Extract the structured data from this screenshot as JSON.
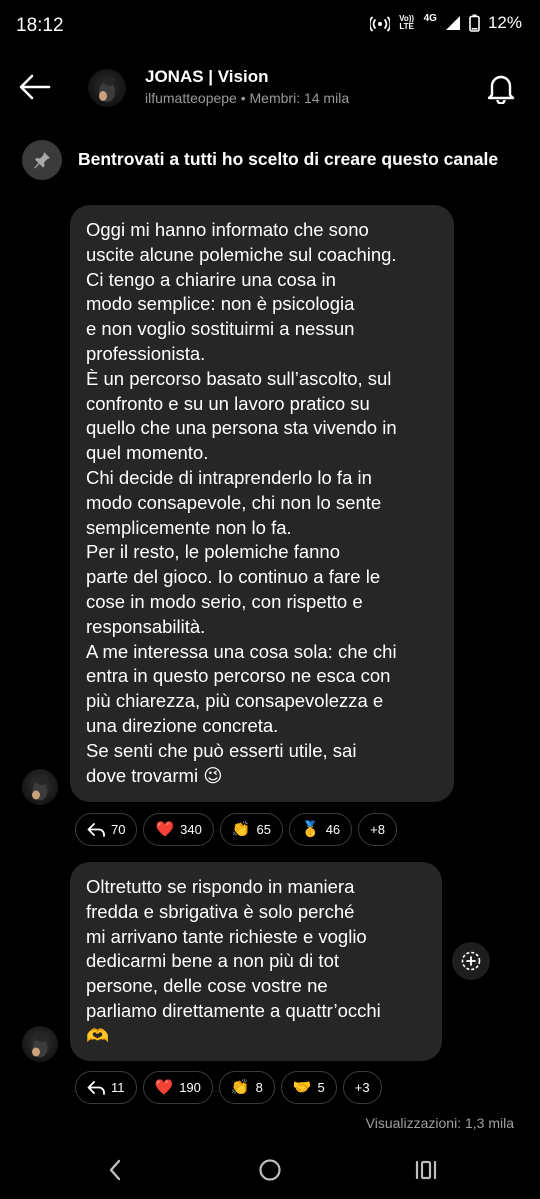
{
  "status_bar": {
    "time": "18:12",
    "volte_label": "Vo)) LTE",
    "network": "4G",
    "battery": "12%"
  },
  "header": {
    "title": "JONAS | Vision",
    "subtitle": "ilfumatteopepe • Membri: 14 mila"
  },
  "pinned": {
    "text": "Bentrovati a tutti ho scelto di creare questo canale"
  },
  "messages": [
    {
      "text": "Oggi mi hanno informato che sono\nuscite alcune polemiche sul coaching.\nCi tengo a chiarire una cosa in\nmodo semplice: non è psicologia\ne non voglio sostituirmi a nessun\nprofessionista.\nÈ un percorso basato sull’ascolto, sul\nconfronto e su un lavoro pratico su\nquello che una persona sta vivendo in\nquel momento.\nChi decide di intraprenderlo lo fa in\nmodo consapevole, chi non lo sente\nsemplicemente non lo fa.\nPer il resto, le polemiche fanno\nparte del gioco. Io continuo a fare le\ncose in modo serio, con rispetto e\nresponsabilità.\nA me interessa una cosa sola: che chi\nentra in questo percorso ne esca con\npiù chiarezza, più consapevolezza e\nuna direzione concreta.\nSe senti che può esserti utile, sai\ndove trovarmi 😉",
      "reactions": [
        {
          "icon": "reply-icon",
          "emoji": "",
          "count": "70"
        },
        {
          "icon": "heart-emoji",
          "emoji": "❤️",
          "count": "340"
        },
        {
          "icon": "clap-emoji",
          "emoji": "👏",
          "count": "65"
        },
        {
          "icon": "medal-emoji",
          "emoji": "🥇",
          "count": "46"
        },
        {
          "icon": "more",
          "emoji": "",
          "count": "+8"
        }
      ]
    },
    {
      "text": "Oltretutto se rispondo in maniera\nfredda e sbrigativa è solo perché\nmi arrivano tante richieste e voglio\ndedicarmi bene a non più di tot\npersone, delle cose vostre ne\nparliamo direttamente a quattr’occhi\n🫶",
      "reactions": [
        {
          "icon": "reply-icon",
          "emoji": "",
          "count": "11"
        },
        {
          "icon": "heart-emoji",
          "emoji": "❤️",
          "count": "190"
        },
        {
          "icon": "clap-emoji",
          "emoji": "👏",
          "count": "8"
        },
        {
          "icon": "handshake-emoji",
          "emoji": "🤝",
          "count": "5"
        },
        {
          "icon": "more",
          "emoji": "",
          "count": "+3"
        }
      ]
    }
  ],
  "views": "Visualizzazioni: 1,3 mila",
  "colors": {
    "background": "#000000",
    "bubble": "#262626",
    "pill_border": "#3b3b3b",
    "secondary_text": "#9a9a9a",
    "heart": "#e0245e"
  }
}
